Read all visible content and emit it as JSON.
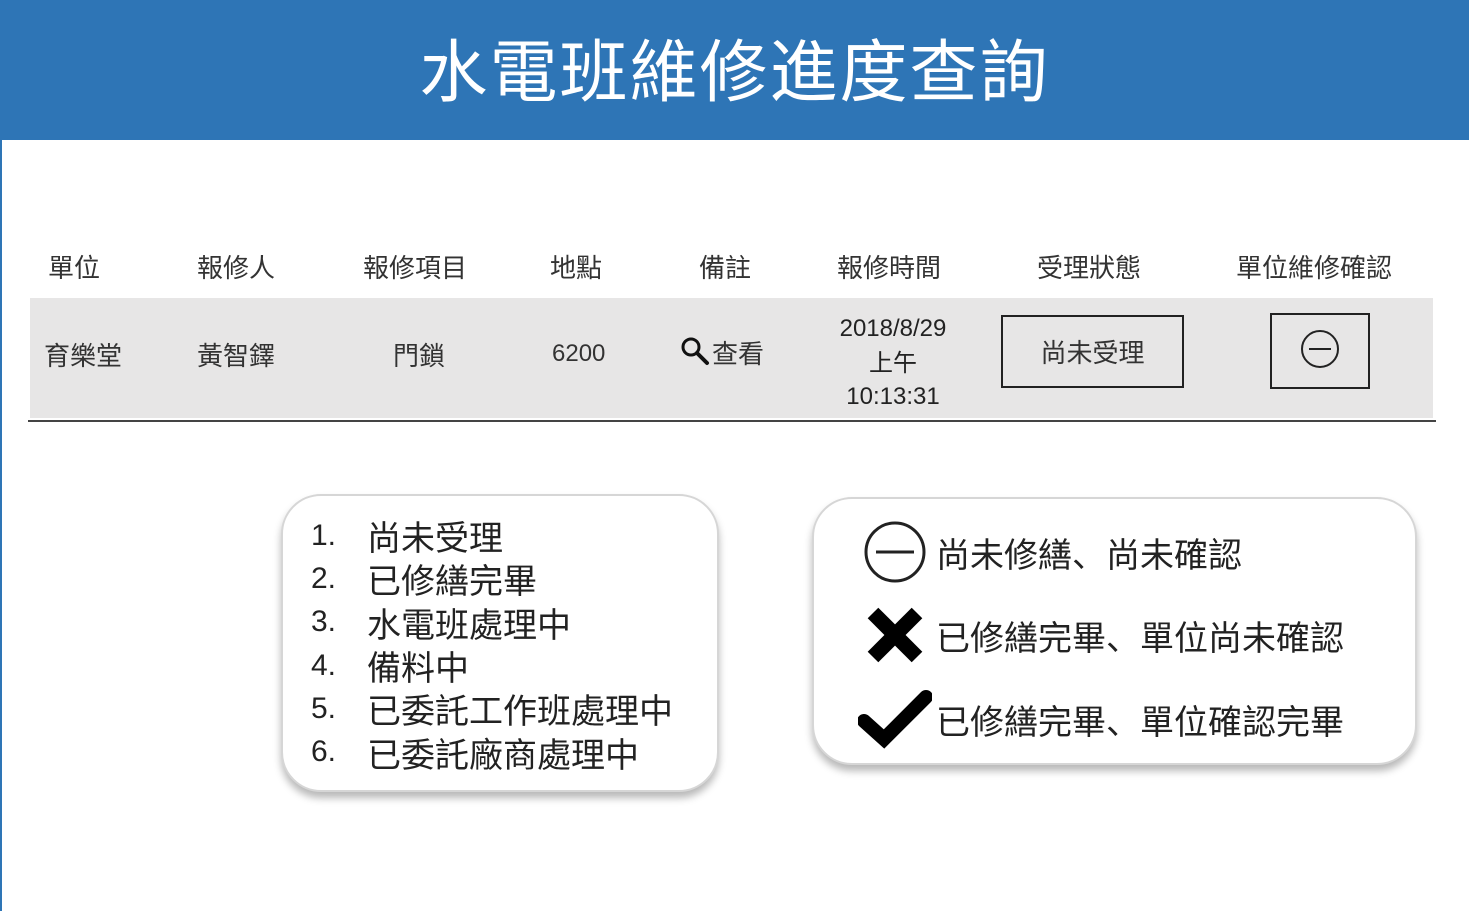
{
  "header": {
    "title": "水電班維修進度查詢"
  },
  "table": {
    "columns": [
      "單位",
      "報修人",
      "報修項目",
      "地點",
      "備註",
      "報修時間",
      "受理狀態",
      "單位維修確認"
    ],
    "row": {
      "unit": "育樂堂",
      "reporter": "黃智鐸",
      "item": "門鎖",
      "location": "6200",
      "remark_link": "查看",
      "time_date": "2018/8/29",
      "time_period": "上午",
      "time_clock": "10:13:31",
      "status": "尚未受理",
      "confirm_icon": "minus-circle-icon"
    }
  },
  "status_legend": [
    {
      "index": "1.",
      "label": "尚未受理"
    },
    {
      "index": "2.",
      "label": "已修繕完畢"
    },
    {
      "index": "3.",
      "label": "水電班處理中"
    },
    {
      "index": "4.",
      "label": "備料中"
    },
    {
      "index": "5.",
      "label": "已委託工作班處理中"
    },
    {
      "index": "6.",
      "label": "已委託廠商處理中"
    }
  ],
  "icon_legend": [
    {
      "icon": "minus-circle-icon",
      "label": "尚未修繕、尚未確認"
    },
    {
      "icon": "cross-icon",
      "label": "已修繕完畢、單位尚未確認"
    },
    {
      "icon": "check-icon",
      "label": "已修繕完畢、單位確認完畢"
    }
  ],
  "colors": {
    "header_bg": "#2E75B6",
    "row_bg": "#E7E6E6",
    "text": "#222222"
  }
}
